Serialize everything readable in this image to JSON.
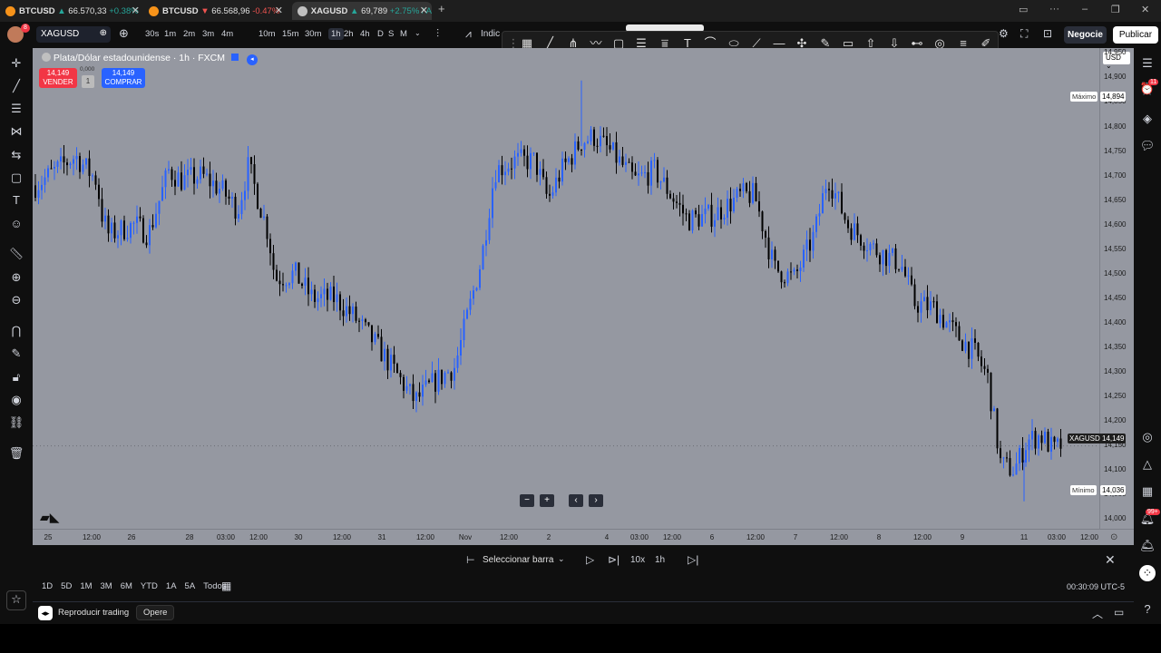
{
  "browser_tabs": [
    {
      "symbol": "BTCUSD",
      "price": "66.570,33",
      "change": "+0.38%",
      "direction": "up",
      "coin_color": "#f7931a"
    },
    {
      "symbol": "BTCUSD",
      "price": "66.568,96",
      "change": "-0.47%",
      "direction": "down",
      "coin_color": "#f7931a"
    },
    {
      "symbol": "XAGUSD",
      "price": "69,789",
      "change": "+2.75% / A",
      "direction": "up",
      "coin_color": "#c0c0c0"
    }
  ],
  "new_tab_label": "+",
  "topbar": {
    "symbol": "XAGUSD",
    "timeframes": [
      "30s",
      "1m",
      "2m",
      "3m",
      "4m",
      "10m",
      "15m",
      "30m",
      "1h",
      "2h",
      "4h",
      "D",
      "S",
      "M"
    ],
    "active_timeframe": "1h",
    "indicators_label": "Indic",
    "trade_button": "Negocie",
    "publish_button": "Publicar",
    "avatar_badge": "8"
  },
  "legend": {
    "title": "Plata/Dólar estadounidense · 1h · FXCM",
    "sell_price": "14,149",
    "sell_label": "VENDER",
    "spread": "0,000",
    "qty": "1",
    "buy_price": "14,149",
    "buy_label": "COMPRAR"
  },
  "price_axis": {
    "currency": "USD",
    "ticks": [
      "14,950",
      "14,900",
      "14,850",
      "14,800",
      "14,750",
      "14,700",
      "14,650",
      "14,600",
      "14,550",
      "14,500",
      "14,450",
      "14,400",
      "14,350",
      "14,300",
      "14,250",
      "14,200",
      "14,150",
      "14,100",
      "14,050",
      "14,000"
    ],
    "max_label": "Máximo",
    "max_value": "14,894",
    "min_label": "Mínimo",
    "min_value": "14,036",
    "last_label": "XAGUSD",
    "last_value": "14,149"
  },
  "time_axis": {
    "ticks": [
      "25",
      "12:00",
      "26",
      "28",
      "03:00",
      "12:00",
      "30",
      "12:00",
      "31",
      "12:00",
      "Nov",
      "12:00",
      "2",
      "4",
      "03:00",
      "12:00",
      "6",
      "12:00",
      "7",
      "12:00",
      "8",
      "12:00",
      "9",
      "11",
      "03:00",
      "12:00"
    ]
  },
  "chart_data": {
    "type": "candlestick",
    "symbol": "XAGUSD",
    "timeframe": "1h",
    "ylim": [
      13.98,
      14.96
    ],
    "high": 14.894,
    "low": 14.036,
    "last": 14.149,
    "path": [
      {
        "x": 0,
        "y": 14.68
      },
      {
        "x": 3,
        "y": 14.74
      },
      {
        "x": 4.6,
        "y": 14.69
      },
      {
        "x": 5,
        "y": 14.62
      },
      {
        "x": 5.5,
        "y": 14.58
      },
      {
        "x": 7.5,
        "y": 14.6
      },
      {
        "x": 8.5,
        "y": 14.58
      },
      {
        "x": 10,
        "y": 14.71
      },
      {
        "x": 11,
        "y": 14.69
      },
      {
        "x": 12.5,
        "y": 14.7
      },
      {
        "x": 14,
        "y": 14.67
      },
      {
        "x": 15.2,
        "y": 14.63
      },
      {
        "x": 16,
        "y": 14.72
      },
      {
        "x": 17.5,
        "y": 14.58
      },
      {
        "x": 18,
        "y": 14.49
      },
      {
        "x": 19.5,
        "y": 14.5
      },
      {
        "x": 20.8,
        "y": 14.45
      },
      {
        "x": 22.5,
        "y": 14.45
      },
      {
        "x": 24,
        "y": 14.41
      },
      {
        "x": 26,
        "y": 14.34
      },
      {
        "x": 28.5,
        "y": 14.24
      },
      {
        "x": 30,
        "y": 14.28
      },
      {
        "x": 31.5,
        "y": 14.31
      },
      {
        "x": 33.5,
        "y": 14.53
      },
      {
        "x": 34.5,
        "y": 14.71
      },
      {
        "x": 36,
        "y": 14.73
      },
      {
        "x": 37.5,
        "y": 14.73
      },
      {
        "x": 38.5,
        "y": 14.65
      },
      {
        "x": 39.5,
        "y": 14.71
      },
      {
        "x": 41,
        "y": 14.77
      },
      {
        "x": 42,
        "y": 14.78
      },
      {
        "x": 43.5,
        "y": 14.74
      },
      {
        "x": 45,
        "y": 14.69
      },
      {
        "x": 46.5,
        "y": 14.71
      },
      {
        "x": 48,
        "y": 14.65
      },
      {
        "x": 49,
        "y": 14.61
      },
      {
        "x": 51,
        "y": 14.62
      },
      {
        "x": 53,
        "y": 14.66
      },
      {
        "x": 54,
        "y": 14.66
      },
      {
        "x": 55.5,
        "y": 14.51
      },
      {
        "x": 57,
        "y": 14.49
      },
      {
        "x": 58.5,
        "y": 14.58
      },
      {
        "x": 59.5,
        "y": 14.7
      },
      {
        "x": 61,
        "y": 14.6
      },
      {
        "x": 63,
        "y": 14.55
      },
      {
        "x": 65,
        "y": 14.52
      },
      {
        "x": 66,
        "y": 14.44
      },
      {
        "x": 67.5,
        "y": 14.43
      },
      {
        "x": 69,
        "y": 14.38
      },
      {
        "x": 70.5,
        "y": 14.34
      },
      {
        "x": 71.5,
        "y": 14.29
      },
      {
        "x": 72.5,
        "y": 14.11
      },
      {
        "x": 73.5,
        "y": 14.1
      },
      {
        "x": 74.5,
        "y": 14.16
      },
      {
        "x": 75.5,
        "y": 14.17
      },
      {
        "x": 76.5,
        "y": 14.14
      },
      {
        "x": 77,
        "y": 14.15
      }
    ]
  },
  "scroll_controls": [
    "−",
    "+",
    "‹",
    "›"
  ],
  "replay": {
    "select_bar": "Seleccionar barra",
    "speed": "10x",
    "interval": "1h"
  },
  "ranges": [
    "1D",
    "5D",
    "1M",
    "3M",
    "6M",
    "YTD",
    "1A",
    "5A",
    "Todos"
  ],
  "clock": "00:30:09 UTC-5",
  "statusbar": {
    "replay_label": "Reproducir trading",
    "trade_label": "Opere"
  },
  "badges": {
    "alerts": "11",
    "notifications": "99+"
  }
}
